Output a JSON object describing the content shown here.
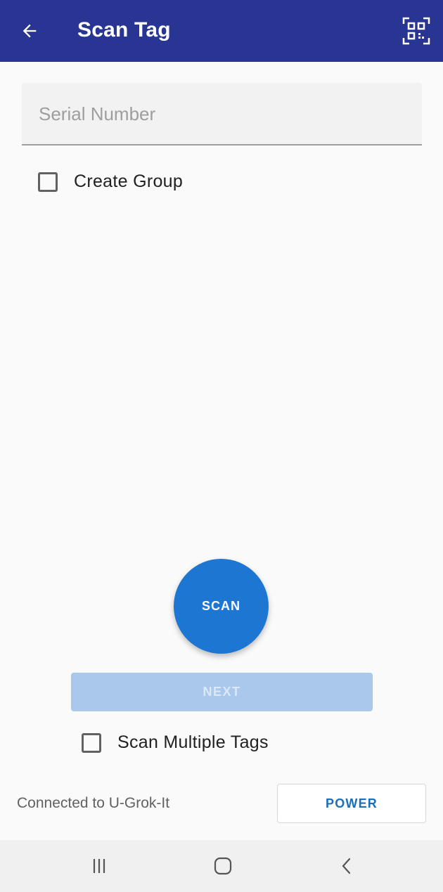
{
  "app_bar": {
    "title": "Scan Tag",
    "back_icon": "arrow-left-icon",
    "qr_icon": "qr-code-scan-icon",
    "color": "#283593"
  },
  "serial_field": {
    "placeholder": "Serial Number",
    "value": ""
  },
  "create_group": {
    "label": "Create Group",
    "checked": false
  },
  "scan_button": {
    "label": "SCAN",
    "color": "#1e76d3"
  },
  "next_button": {
    "label": "NEXT",
    "enabled": false
  },
  "scan_multiple": {
    "label": "Scan Multiple Tags",
    "checked": false
  },
  "footer": {
    "status": "Connected to U-Grok-It",
    "power_label": "POWER"
  },
  "system_nav": {
    "recents_icon": "recents-icon",
    "home_icon": "home-icon",
    "back_icon": "nav-back-icon"
  }
}
